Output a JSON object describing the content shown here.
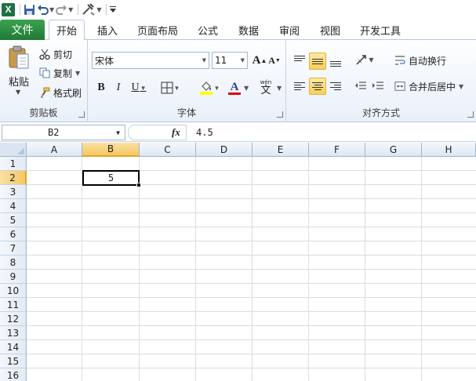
{
  "quick_access": {
    "icons": [
      "excel-logo-icon",
      "save-icon",
      "undo-icon",
      "redo-icon",
      "tools-icon",
      "customize-icon"
    ],
    "logo_letter": "X"
  },
  "tabs": {
    "file": "文件",
    "items": [
      "开始",
      "插入",
      "页面布局",
      "公式",
      "数据",
      "审阅",
      "视图",
      "开发工具"
    ],
    "active_index": 0
  },
  "ribbon": {
    "clipboard": {
      "paste": "粘贴",
      "cut": "剪切",
      "copy": "复制",
      "format_painter": "格式刷",
      "group_label": "剪贴板"
    },
    "font": {
      "font_name": "宋体",
      "font_size": "11",
      "bold": "B",
      "italic": "I",
      "underline": "U",
      "grow": "A",
      "shrink": "A",
      "font_color_letter": "A",
      "phonetic": "文",
      "phonetic_top": "wén",
      "group_label": "字体"
    },
    "alignment": {
      "wrap_text": "自动换行",
      "merge_center": "合并后居中",
      "group_label": "对齐方式"
    }
  },
  "formula_bar": {
    "name_box": "B2",
    "fx": "fx",
    "content": "4.5"
  },
  "sheet": {
    "columns": [
      "A",
      "B",
      "C",
      "D",
      "E",
      "F",
      "G",
      "H"
    ],
    "rows": [
      "1",
      "2",
      "3",
      "4",
      "5",
      "6",
      "7",
      "8",
      "9",
      "10",
      "11",
      "12",
      "13",
      "14",
      "15",
      "16"
    ],
    "selected_column": "B",
    "selected_row": "2",
    "cell_b2_display": "5"
  },
  "colors": {
    "file_tab": "#217a35",
    "selection_header": "#f5c764",
    "highlight_yellow": "#ffff00",
    "font_red": "#e00000"
  }
}
